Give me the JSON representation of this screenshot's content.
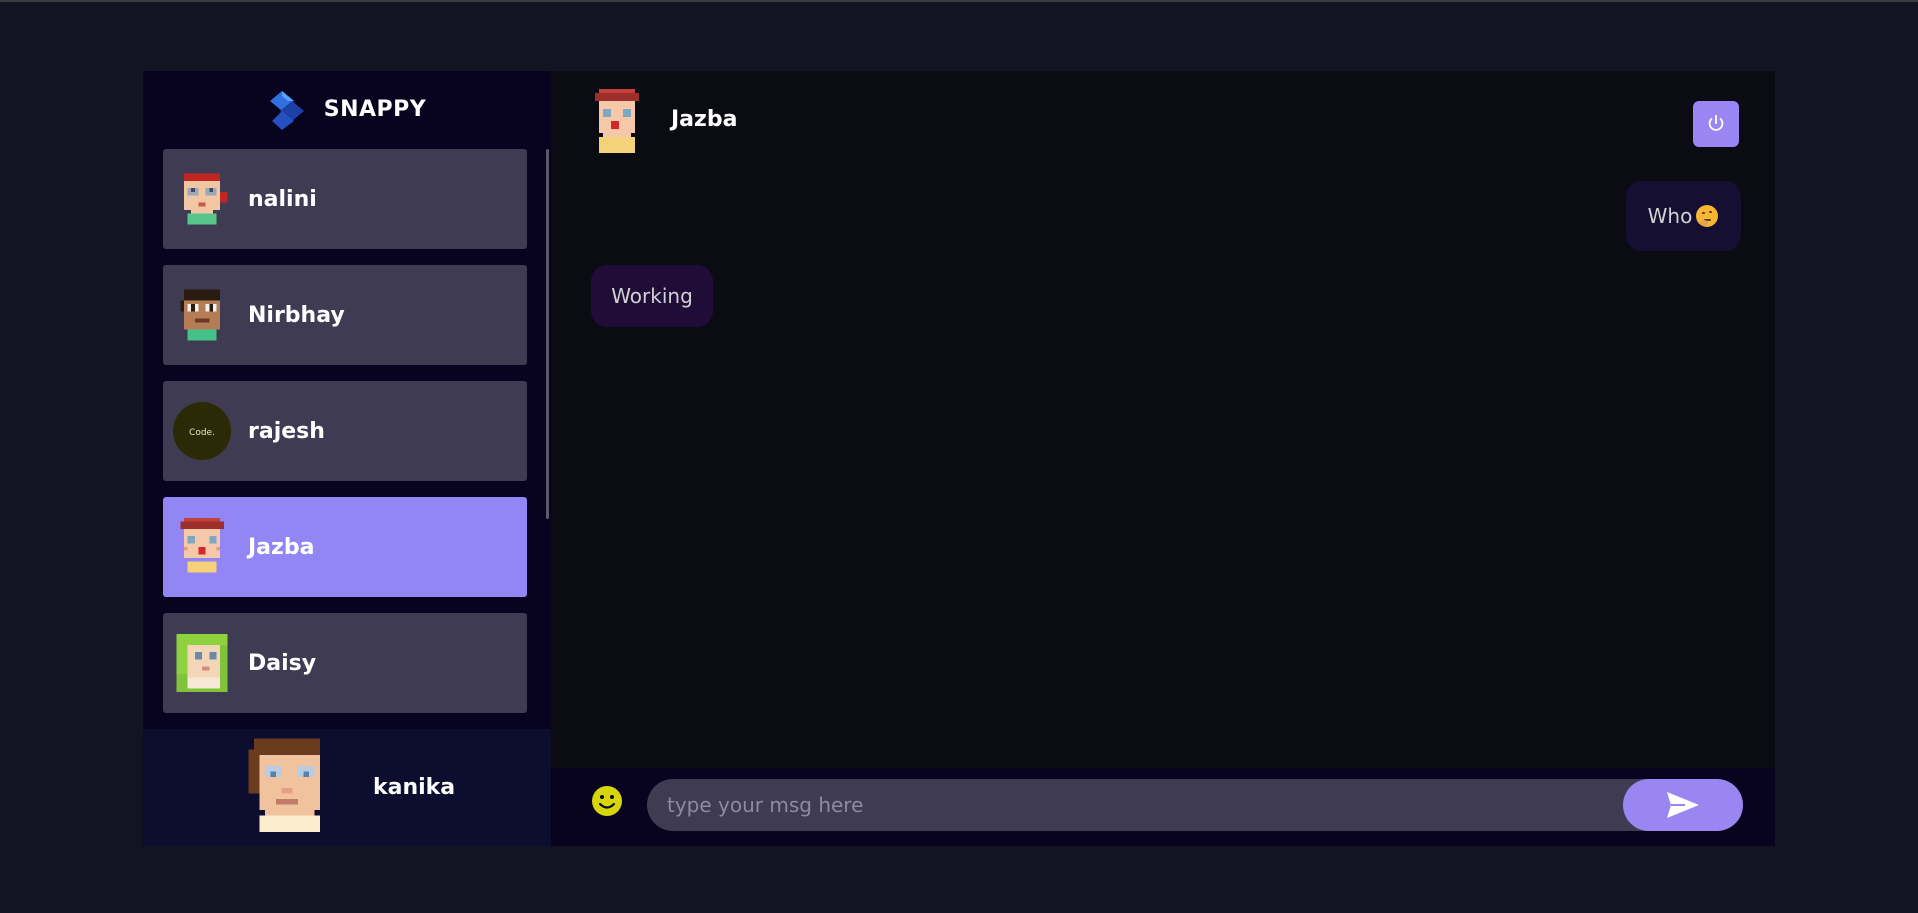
{
  "app": {
    "brand_name": "SNAPPY"
  },
  "contacts": [
    {
      "name": "nalini",
      "avatar": "nalini-avatar"
    },
    {
      "name": "Nirbhay",
      "avatar": "nirbhay-avatar"
    },
    {
      "name": "rajesh",
      "avatar": "code-logo-avatar",
      "avatar_text": "Code."
    },
    {
      "name": "Jazba",
      "avatar": "jazba-avatar",
      "active": true
    },
    {
      "name": "Daisy",
      "avatar": "daisy-avatar"
    }
  ],
  "current_user": {
    "name": "kanika",
    "avatar": "kanika-avatar"
  },
  "chat": {
    "contact_name": "Jazba",
    "logout_icon": "power-icon",
    "messages": [
      {
        "direction": "sent",
        "text": "Who",
        "emoji": "thinking-face-emoji"
      },
      {
        "direction": "received",
        "text": "Working"
      }
    ],
    "input_placeholder": "type your msg here",
    "emoji_button_icon": "smiley-icon",
    "send_button_icon": "send-icon"
  },
  "colors": {
    "accent": "#9a86f3",
    "active_contact": "#9186f3",
    "contact_bg": "#3f3b52",
    "sidebar_bg": "#080420",
    "chat_bg": "#0b0b13",
    "page_bg": "#131324"
  }
}
